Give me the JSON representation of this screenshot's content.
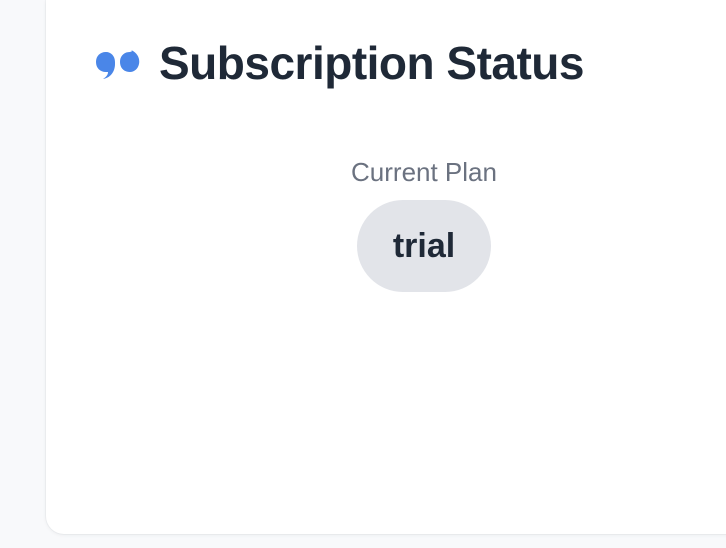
{
  "header": {
    "icon": "quote-icon",
    "title": "Subscription Status",
    "accent_color": "#4a86e8"
  },
  "plan": {
    "label": "Current Plan",
    "value": "trial"
  }
}
